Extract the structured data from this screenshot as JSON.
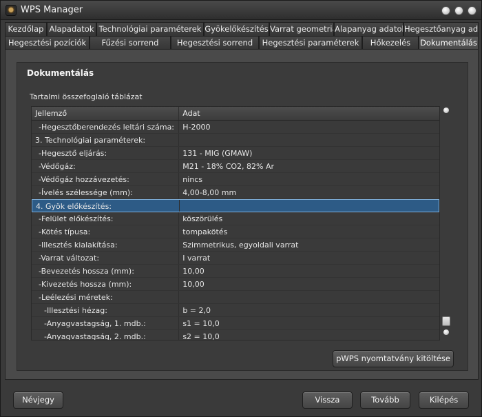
{
  "window": {
    "title": "WPS Manager"
  },
  "tabs_row1": [
    {
      "label": "Kezdőlap"
    },
    {
      "label": "Alapadatok"
    },
    {
      "label": "Technológiai paraméterek"
    },
    {
      "label": "Gyökelőkészítés"
    },
    {
      "label": "Varrat geometria"
    },
    {
      "label": "Alapanyag adatok"
    },
    {
      "label": "Hegesztőanyag adatok"
    }
  ],
  "tabs_row2": [
    {
      "label": "Hegesztési pozíciók"
    },
    {
      "label": "Fűzési sorrend"
    },
    {
      "label": "Hegesztési sorrend"
    },
    {
      "label": "Hegesztési paraméterek"
    },
    {
      "label": "Hőkezelés"
    },
    {
      "label": "Dokumentálás",
      "active": true
    }
  ],
  "panel": {
    "title": "Dokumentálás",
    "subtitle": "Tartalmi összefoglaló táblázat"
  },
  "table": {
    "headers": [
      "Jellemző",
      "Adat"
    ],
    "rows": [
      {
        "feature": "-Hegesztőberendezés leltári száma:",
        "value": "H-2000",
        "indent": 1
      },
      {
        "feature": "3. Technológiai paraméterek:",
        "value": "",
        "indent": 0
      },
      {
        "feature": "-Hegesztő eljárás:",
        "value": "131 - MIG (GMAW)",
        "indent": 1
      },
      {
        "feature": "-Védőgáz:",
        "value": "M21 - 18% CO2, 82% Ar",
        "indent": 1
      },
      {
        "feature": "-Védőgáz hozzávezetés:",
        "value": "nincs",
        "indent": 1
      },
      {
        "feature": "-Ívelés szélessége (mm):",
        "value": "4,00-8,00 mm",
        "indent": 1
      },
      {
        "feature": "4. Gyök előkészítés:",
        "value": "",
        "indent": 0,
        "selected": true
      },
      {
        "feature": "-Felület előkészítés:",
        "value": "köszörülés",
        "indent": 1
      },
      {
        "feature": "-Kötés típusa:",
        "value": "tompakötés",
        "indent": 1
      },
      {
        "feature": "-Illesztés kialakítása:",
        "value": "Szimmetrikus, egyoldali varrat",
        "indent": 1
      },
      {
        "feature": "-Varrat változat:",
        "value": "I varrat",
        "indent": 1
      },
      {
        "feature": "-Bevezetés hossza (mm):",
        "value": "10,00",
        "indent": 1
      },
      {
        "feature": "-Kivezetés hossza (mm):",
        "value": "10,00",
        "indent": 1
      },
      {
        "feature": "-Leélezési méretek:",
        "value": "",
        "indent": 1
      },
      {
        "feature": "-Illesztési hézag:",
        "value": "b = 2,0",
        "indent": 2
      },
      {
        "feature": "-Anyagvastagság, 1. mdb.:",
        "value": "s1 = 10,0",
        "indent": 2
      },
      {
        "feature": "-Anyagvastagság, 2. mdb.:",
        "value": "s2 = 10,0",
        "indent": 2
      }
    ]
  },
  "buttons": {
    "print": "pWPS nyomtatvány kitöltése",
    "about": "Névjegy",
    "back": "Vissza",
    "next": "Tovább",
    "exit": "Kilépés"
  }
}
